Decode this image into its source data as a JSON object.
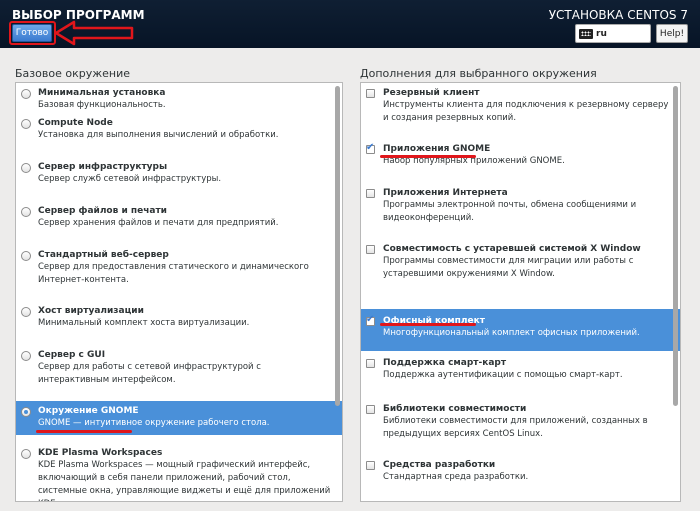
{
  "header": {
    "title": "ВЫБОР ПРОГРАММ",
    "done_label": "Готово",
    "product": "УСТАНОВКА CENTOS 7",
    "keyboard_layout": "ru",
    "help_label": "Help!"
  },
  "left": {
    "label": "Базовое окружение",
    "items": [
      {
        "title": "Минимальная установка",
        "desc": "Базовая функциональность."
      },
      {
        "title": "Compute Node",
        "desc": "Установка для выполнения вычислений и обработки."
      },
      {
        "title": "Сервер инфраструктуры",
        "desc": "Сервер служб сетевой инфраструктуры."
      },
      {
        "title": "Сервер файлов и печати",
        "desc": "Сервер хранения файлов и печати для предприятий."
      },
      {
        "title": "Стандартный веб-сервер",
        "desc": "Сервер для предоставления статического и динамического Интернет-контента."
      },
      {
        "title": "Хост виртуализации",
        "desc": "Минимальный комплект хоста виртуализации."
      },
      {
        "title": "Сервер с GUI",
        "desc": "Сервер для работы с сетевой инфраструктурой с интерактивным интерфейсом."
      },
      {
        "title": "Окружение GNOME",
        "desc": "GNOME — интуитивное окружение рабочего стола.",
        "selected": true
      },
      {
        "title": "KDE Plasma Workspaces",
        "desc": "KDE Plasma Workspaces — мощный графический интерфейс, включающий в себя панели приложений, рабочий стол, системные окна, управляющие виджеты и ещё для приложений KDE"
      }
    ]
  },
  "right": {
    "label": "Дополнения для выбранного окружения",
    "items": [
      {
        "title": "Резервный клиент",
        "desc": "Инструменты клиента для подключения к резервному серверу и создания резервных копий."
      },
      {
        "title": "Приложения GNOME",
        "desc": "Набор популярных приложений GNOME.",
        "checked": true
      },
      {
        "title": "Приложения Интернета",
        "desc": "Программы электронной почты, обмена сообщениями и видеоконференций."
      },
      {
        "title": "Совместимость с устаревшей системой X Window",
        "desc": "Программы совместимости для миграции или работы с устаревшими окружениями X Window."
      },
      {
        "title": "Офисный комплект",
        "desc": "Многофункциональный комплект офисных приложений.",
        "checked": true,
        "selected": true
      },
      {
        "title": "Поддержка смарт-карт",
        "desc": "Поддержка аутентификации с помощью смарт-карт."
      },
      {
        "title": "Библиотеки совместимости",
        "desc": "Библиотеки совместимости для приложений, созданных в предыдущих версиях CentOS Linux."
      },
      {
        "title": "Средства разработки",
        "desc": "Стандартная среда разработки."
      }
    ]
  }
}
